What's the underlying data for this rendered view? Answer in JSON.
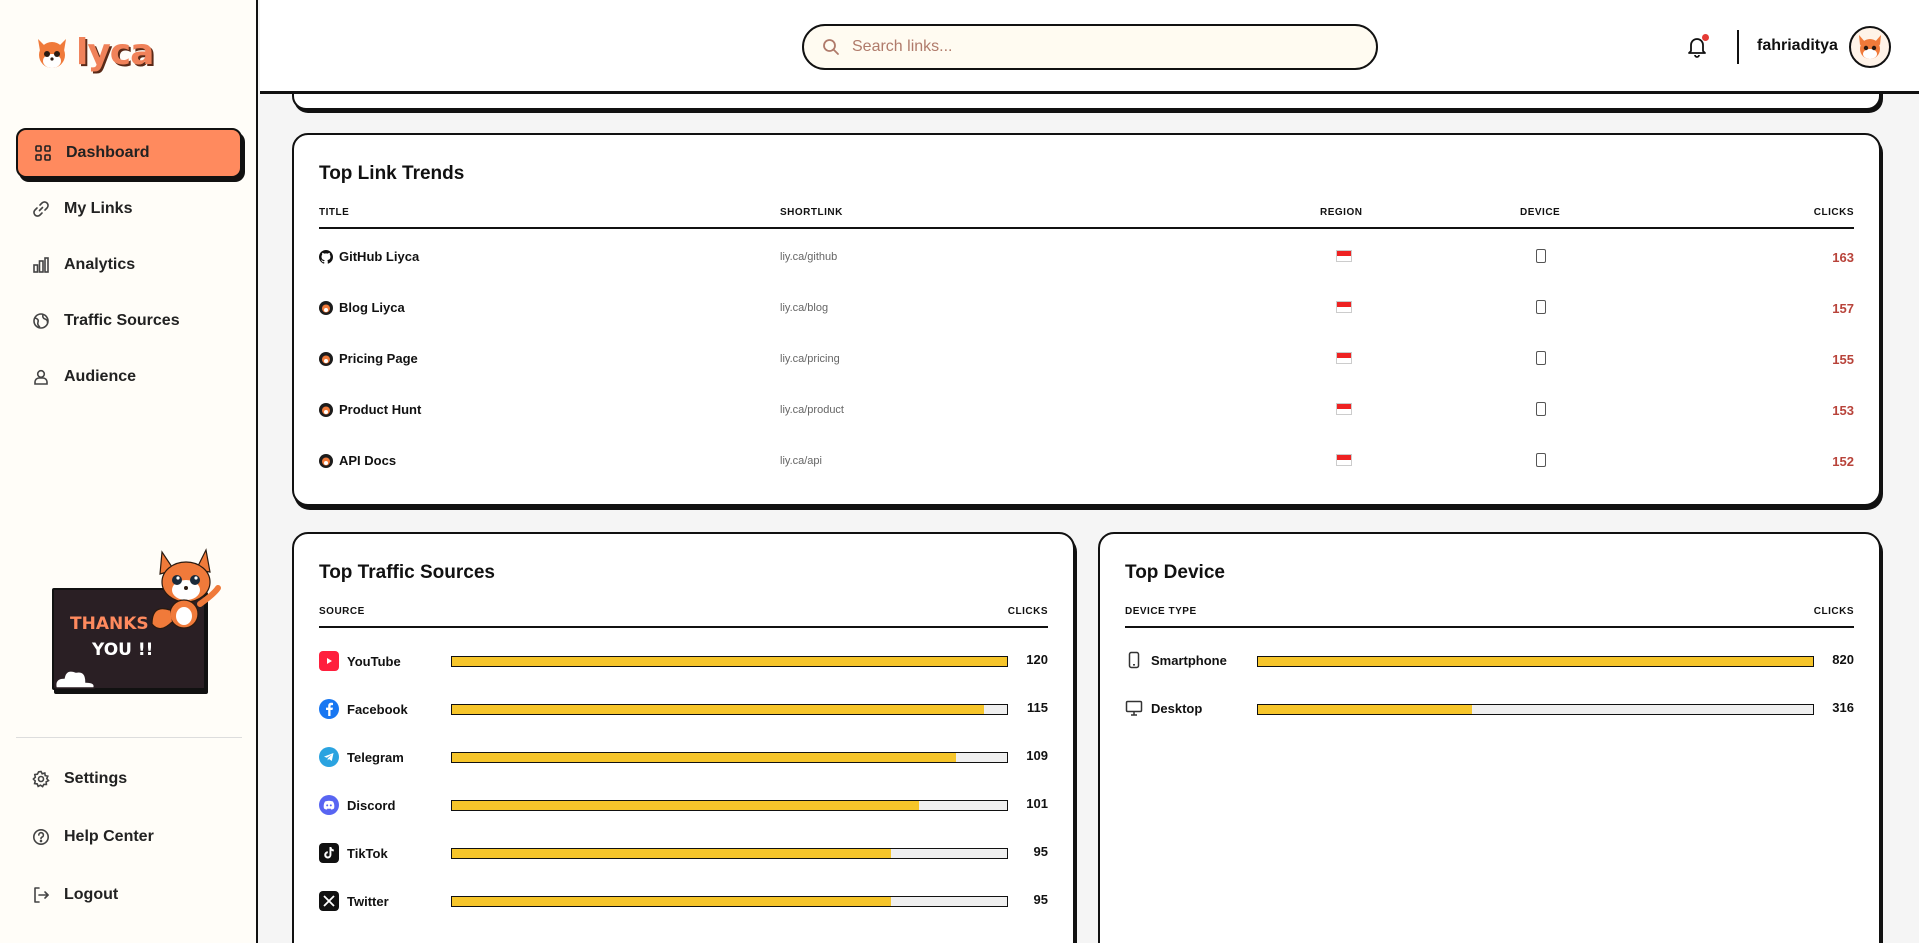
{
  "sidebar": {
    "brand": "lyca",
    "nav": [
      {
        "label": "Dashboard",
        "icon": "grid-icon",
        "active": true
      },
      {
        "label": "My Links",
        "icon": "link-icon"
      },
      {
        "label": "Analytics",
        "icon": "bar-chart-icon"
      },
      {
        "label": "Traffic Sources",
        "icon": "globe-icon"
      },
      {
        "label": "Audience",
        "icon": "users-icon"
      }
    ],
    "promo": {
      "line1": "THANKS",
      "line2": "YOU !!"
    },
    "bottom_nav": [
      {
        "label": "Settings",
        "icon": "gear-icon"
      },
      {
        "label": "Help Center",
        "icon": "help-icon"
      },
      {
        "label": "Logout",
        "icon": "logout-icon"
      }
    ]
  },
  "header": {
    "search_placeholder": "Search links...",
    "username": "fahriaditya"
  },
  "trends": {
    "title": "Top Link Trends",
    "columns": {
      "title": "TITLE",
      "shortlink": "SHORTLINK",
      "region": "REGION",
      "device": "DEVICE",
      "clicks": "CLICKS"
    },
    "rows": [
      {
        "title": "GitHub Liyca",
        "icon": "github-icon",
        "shortlink": "liy.ca/github",
        "clicks": "163"
      },
      {
        "title": "Blog Liyca",
        "icon": "fox-icon",
        "shortlink": "liy.ca/blog",
        "clicks": "157"
      },
      {
        "title": "Pricing Page",
        "icon": "fox-icon",
        "shortlink": "liy.ca/pricing",
        "clicks": "155"
      },
      {
        "title": "Product Hunt",
        "icon": "fox-icon",
        "shortlink": "liy.ca/product",
        "clicks": "153"
      },
      {
        "title": "API Docs",
        "icon": "fox-icon",
        "shortlink": "liy.ca/api",
        "clicks": "152"
      }
    ]
  },
  "sources": {
    "title": "Top Traffic Sources",
    "col_source": "SOURCE",
    "col_clicks": "CLICKS",
    "max": 120,
    "rows": [
      {
        "name": "YouTube",
        "icon": "youtube-icon",
        "color": "#ff1f3d",
        "clicks": 120
      },
      {
        "name": "Facebook",
        "icon": "facebook-icon",
        "color": "#1877f2",
        "clicks": 115
      },
      {
        "name": "Telegram",
        "icon": "telegram-icon",
        "color": "#2aa3e0",
        "clicks": 109
      },
      {
        "name": "Discord",
        "icon": "discord-icon",
        "color": "#5865f2",
        "clicks": 101
      },
      {
        "name": "TikTok",
        "icon": "tiktok-icon",
        "color": "#111111",
        "clicks": 95
      },
      {
        "name": "Twitter",
        "icon": "x-icon",
        "color": "#111111",
        "clicks": 95
      }
    ]
  },
  "devices": {
    "title": "Top Device",
    "col_type": "DEVICE TYPE",
    "col_clicks": "CLICKS",
    "max": 820,
    "rows": [
      {
        "name": "Smartphone",
        "icon": "smartphone-icon",
        "clicks": 820
      },
      {
        "name": "Desktop",
        "icon": "desktop-icon",
        "clicks": 316
      }
    ]
  },
  "colors": {
    "accent": "#ff8a5e",
    "bar_fill": "#f6c52a",
    "clicks_text": "#b8433a"
  }
}
